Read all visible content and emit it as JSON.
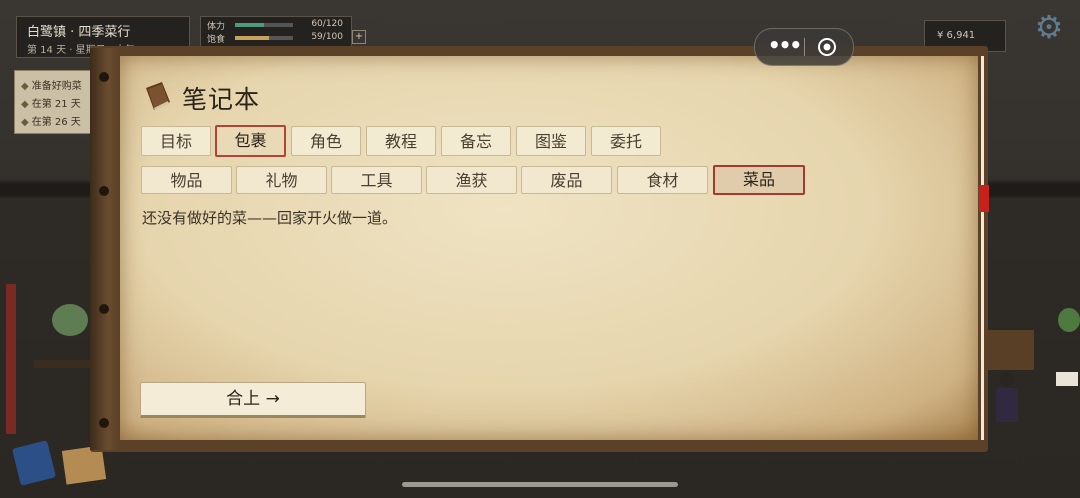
{
  "hud": {
    "location": "白鹭镇 · 四季菜行",
    "date": "第 14 天 · 星期日 · 中午",
    "stats": [
      {
        "name": "体力",
        "value": "60/120",
        "fraction": 0.5,
        "color": "#4f9a7a"
      },
      {
        "name": "饱食",
        "value": "59/100",
        "fraction": 0.59,
        "color": "#c8a25a"
      }
    ],
    "plus": "+",
    "money": "¥ 6,941"
  },
  "tasks": [
    {
      "icon": "◆",
      "text": "准备好购菜"
    },
    {
      "icon": "◆",
      "text": "在第 21 天"
    },
    {
      "icon": "◆",
      "text": "在第 26 天"
    }
  ],
  "capsule": {
    "dots": "•••"
  },
  "notebook": {
    "title": "笔记本",
    "tabs": [
      {
        "label": "目标",
        "active": false
      },
      {
        "label": "包裹",
        "active": true
      },
      {
        "label": "角色",
        "active": false
      },
      {
        "label": "教程",
        "active": false
      },
      {
        "label": "备忘",
        "active": false
      },
      {
        "label": "图鉴",
        "active": false
      },
      {
        "label": "委托",
        "active": false
      }
    ],
    "subtabs": [
      {
        "label": "物品",
        "active": false
      },
      {
        "label": "礼物",
        "active": false
      },
      {
        "label": "工具",
        "active": false
      },
      {
        "label": "渔获",
        "active": false
      },
      {
        "label": "废品",
        "active": false
      },
      {
        "label": "食材",
        "active": false
      },
      {
        "label": "菜品",
        "active": true
      }
    ],
    "empty_message": "还没有做好的菜——回家开火做一道。",
    "close_button": "合上 →"
  }
}
